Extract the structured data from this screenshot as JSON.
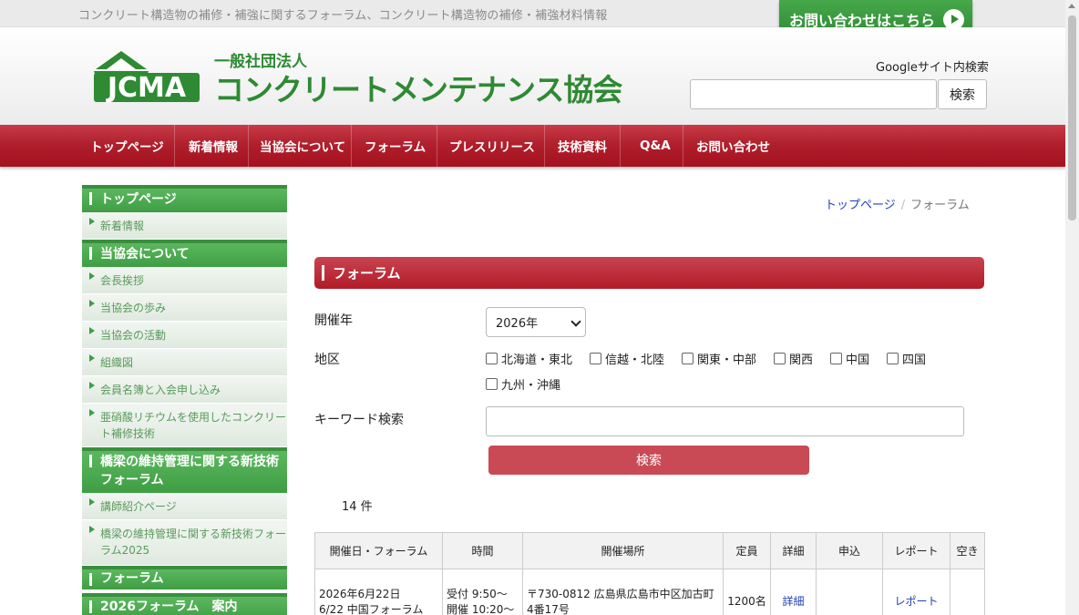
{
  "topbar": {
    "tagline": "コンクリート構造物の補修・補強に関するフォーラム、コンクリート構造物の補修・補強材料情報",
    "contact_button": "お問い合わせはこちら"
  },
  "header": {
    "logo_text": "JCMA",
    "org_type": "一般社団法人",
    "org_name": "コンクリートメンテナンス協会",
    "search_label": "Googleサイト内検索",
    "search_button": "検索"
  },
  "nav": {
    "items": [
      "トップページ",
      "新着情報",
      "当協会について",
      "フォーラム",
      "プレスリリース",
      "技術資料",
      "Q&A",
      "お問い合わせ"
    ]
  },
  "sidebar": {
    "sections": [
      {
        "type": "head",
        "label": "トップページ"
      },
      {
        "type": "item",
        "label": "新着情報"
      },
      {
        "type": "head",
        "label": "当協会について"
      },
      {
        "type": "item",
        "label": "会長挨拶"
      },
      {
        "type": "item",
        "label": "当協会の歩み"
      },
      {
        "type": "item",
        "label": "当協会の活動"
      },
      {
        "type": "item",
        "label": "組織図"
      },
      {
        "type": "item",
        "label": "会員名簿と入会申し込み"
      },
      {
        "type": "item",
        "label": "亜硝酸リチウムを使用したコンクリート補修技術"
      },
      {
        "type": "head",
        "label": "橋梁の維持管理に関する新技術フォーラム"
      },
      {
        "type": "item",
        "label": "講師紹介ページ"
      },
      {
        "type": "item",
        "label": "橋梁の維持管理に関する新技術フォーラム2025"
      },
      {
        "type": "head",
        "label": "フォーラム"
      },
      {
        "type": "head",
        "label": "2026フォーラム　案内"
      }
    ]
  },
  "breadcrumb": {
    "home": "トップページ",
    "separator": "/",
    "current": "フォーラム"
  },
  "main": {
    "title": "フォーラム",
    "year_label": "開催年",
    "year_value": "2026年",
    "region_label": "地区",
    "regions": [
      "北海道・東北",
      "信越・北陸",
      "関東・中部",
      "関西",
      "中国",
      "四国",
      "九州・沖縄"
    ],
    "keyword_label": "キーワード検索",
    "keyword_value": "",
    "search_button": "検索",
    "result_count": "14 件"
  },
  "table": {
    "headers": [
      "開催日・フォーラム",
      "時間",
      "開催場所",
      "定員",
      "詳細",
      "申込",
      "レポート",
      "空き"
    ],
    "rows": [
      {
        "date": "2026年6月22日",
        "forum": "6/22 中国フォーラム",
        "time_1": "受付 9:50～",
        "time_2": "開催 10:20～",
        "place": "〒730-0812 広島県広島市中区加古町4番17号",
        "capacity": "1200名",
        "detail": "詳細",
        "apply": "",
        "report": "レポート",
        "vacancy": ""
      }
    ]
  },
  "colors": {
    "brand_green": "#3f9d43",
    "brand_red": "#b0202d",
    "link_blue": "#1f3fb8"
  }
}
